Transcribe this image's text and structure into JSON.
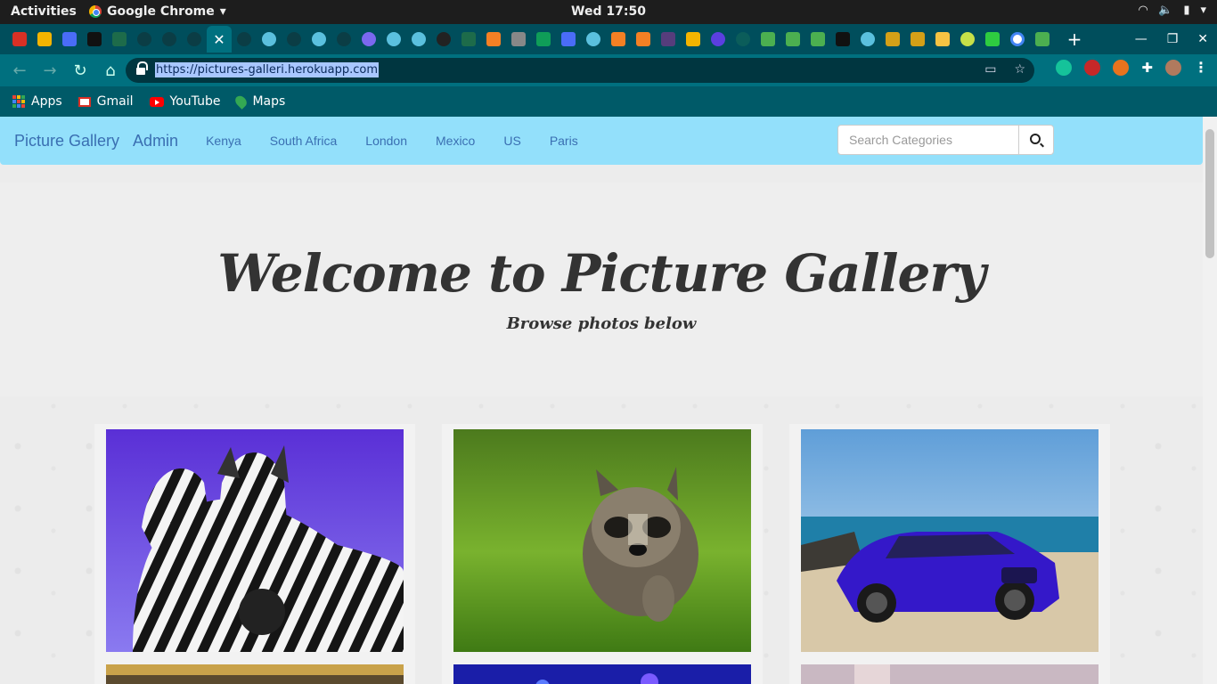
{
  "desktop": {
    "activities": "Activities",
    "app_name": "Google Chrome",
    "clock": "Wed 17:50"
  },
  "browser": {
    "url": "https://pictures-galleri.herokuapp.com",
    "bookmarks": [
      {
        "label": "Apps",
        "icon": "apps-grid-icon"
      },
      {
        "label": "Gmail",
        "icon": "gmail-icon"
      },
      {
        "label": "YouTube",
        "icon": "youtube-icon"
      },
      {
        "label": "Maps",
        "icon": "maps-icon"
      }
    ],
    "accent_color": "#00707f"
  },
  "site": {
    "brand": "Picture Gallery",
    "admin": "Admin",
    "nav": [
      "Kenya",
      "South Africa",
      "London",
      "Mexico",
      "US",
      "Paris"
    ],
    "search_placeholder": "Search Categories",
    "hero_title": "Welcome to Picture Gallery",
    "hero_subtitle": "Browse photos below",
    "navbar_color": "#93e0fb"
  },
  "gallery": [
    {
      "subject": "zebras"
    },
    {
      "subject": "raccoon"
    },
    {
      "subject": "blue car on beach"
    }
  ]
}
